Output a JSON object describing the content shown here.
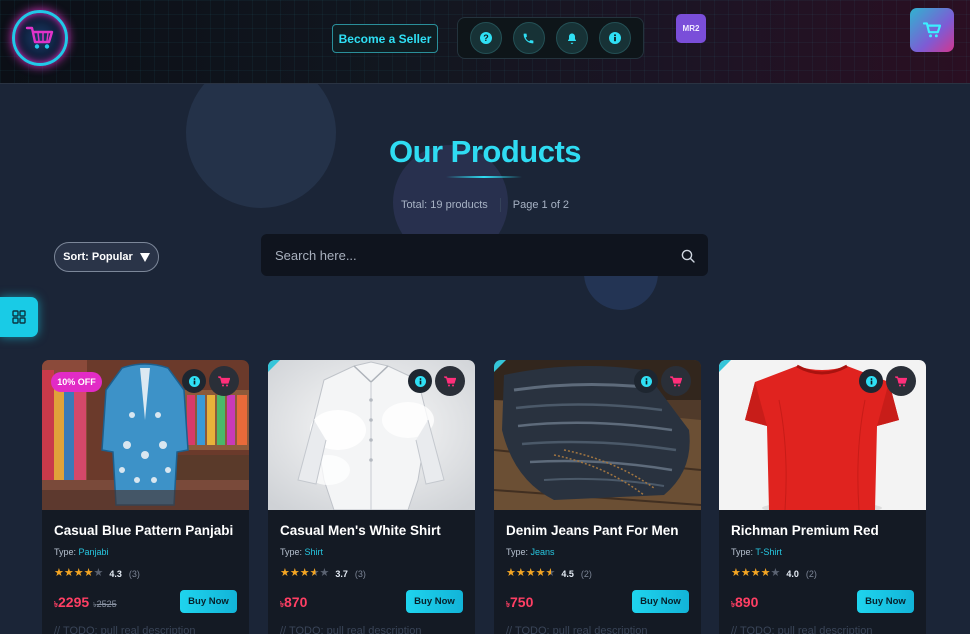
{
  "header": {
    "seller_label": "Become a Seller",
    "user_badge": "MR2",
    "icons": [
      "question-icon",
      "phone-icon",
      "bell-icon",
      "info-icon"
    ]
  },
  "main": {
    "title": "Our Products",
    "total": "Total: 19 products",
    "page": "Page 1 of 2",
    "sort_label": "Sort: Popular",
    "search_placeholder": "Search here..."
  },
  "products": [
    {
      "name": "Casual Blue Pattern Panjabi",
      "type_label": "Type:",
      "type": "Panjabi",
      "rating": "4.3",
      "rating_value": 4.3,
      "reviews": "(3)",
      "currency": "৳",
      "price": "2295",
      "old_price": "2525",
      "discount": "10% OFF",
      "buy_label": "Buy Now",
      "description": "// TODO: pull real description"
    },
    {
      "name": "Casual Men's White Shirt",
      "type_label": "Type:",
      "type": "Shirt",
      "rating": "3.7",
      "rating_value": 3.7,
      "reviews": "(3)",
      "currency": "৳",
      "price": "870",
      "buy_label": "Buy Now",
      "description": "// TODO: pull real description"
    },
    {
      "name": "Denim Jeans Pant For Men",
      "type_label": "Type:",
      "type": "Jeans",
      "rating": "4.5",
      "rating_value": 4.5,
      "reviews": "(2)",
      "currency": "৳",
      "price": "750",
      "buy_label": "Buy Now",
      "description": "// TODO: pull real description"
    },
    {
      "name": "Richman Premium Red",
      "type_label": "Type:",
      "type": "T-Shirt",
      "rating": "4.0",
      "rating_value": 4.0,
      "reviews": "(2)",
      "currency": "৳",
      "price": "890",
      "buy_label": "Buy Now",
      "description": "// TODO: pull real description"
    }
  ],
  "colors": {
    "accent": "#2fdcf2",
    "price": "#ff3f64",
    "discount": "#e22bc6",
    "star": "#f5a623",
    "background": "#1b2537"
  }
}
